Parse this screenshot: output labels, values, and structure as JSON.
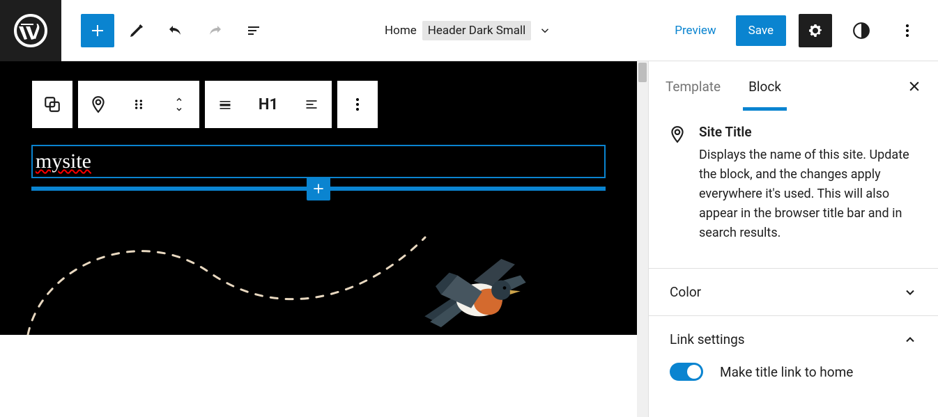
{
  "accent_color": "#0a84d0",
  "topbar": {
    "breadcrumb_home": "Home",
    "breadcrumb_current": "Header Dark Small",
    "preview_label": "Preview",
    "save_label": "Save"
  },
  "editor": {
    "site_title_value": "mysite",
    "heading_level": "H1"
  },
  "sidebar": {
    "tab_template": "Template",
    "tab_block": "Block",
    "block_title": "Site Title",
    "block_description": "Displays the name of this site. Update the block, and the changes apply everywhere it's used. This will also appear in the browser title bar and in search results.",
    "section_color": "Color",
    "section_link_settings": "Link settings",
    "toggle_home_label": "Make title link to home",
    "toggle_home_on": true
  }
}
